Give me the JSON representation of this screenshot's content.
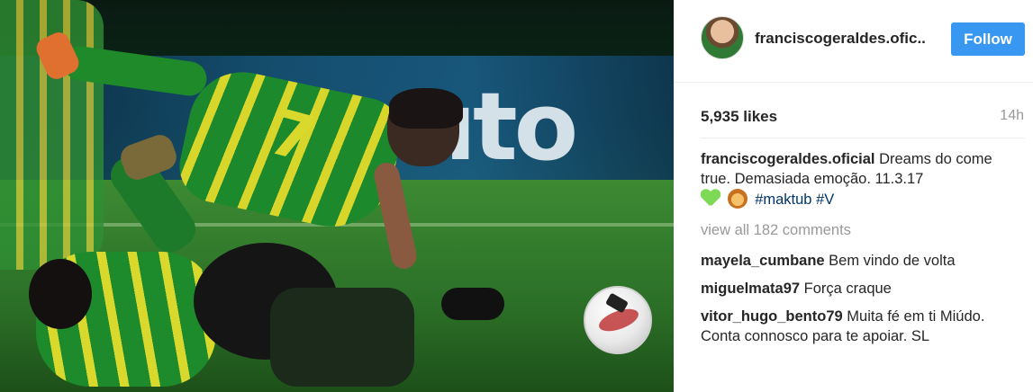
{
  "post": {
    "username_header": "franciscogeraldes.ofic..",
    "follow_label": "Follow",
    "likes": "5,935 likes",
    "time_ago": "14h",
    "caption": {
      "username": "franciscogeraldes.oficial",
      "text": "Dreams do come true. Demasiada emoção. 11.3.17",
      "emoji_1": "green-heart-emoji",
      "emoji_2": "lion-emoji",
      "hashtags": [
        "#maktub",
        "#V"
      ]
    },
    "view_all_comments": "view all 182 comments",
    "comments": [
      {
        "username": "mayela_cumbane",
        "text": "Bem vindo de volta"
      },
      {
        "username": "miguelmata97",
        "text": "Força craque"
      },
      {
        "username": "vitor_hugo_bento79",
        "text": "Muita fé em ti Miúdo. Conta connosco para te apoiar. SL"
      }
    ]
  },
  "photo": {
    "board_text": "uto",
    "jersey_number": "7",
    "accent_colors": {
      "tondela_green": "#1c8a2c",
      "tondela_yellow": "#d8d62a",
      "instagram_blue": "#3897f0"
    }
  }
}
